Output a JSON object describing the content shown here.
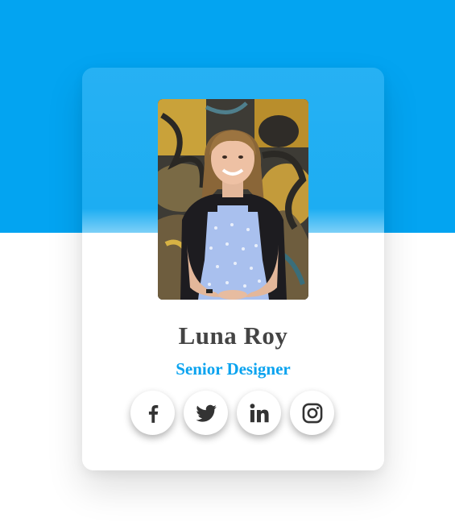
{
  "profile": {
    "name": "Luna Roy",
    "title": "Senior Designer"
  },
  "social_links": [
    {
      "icon": "facebook-icon"
    },
    {
      "icon": "twitter-icon"
    },
    {
      "icon": "linkedin-icon"
    },
    {
      "icon": "instagram-icon"
    }
  ],
  "colors": {
    "accent": "#03a4f1",
    "name_text": "#444444",
    "title_text": "#0aa3ef",
    "icon": "#333333"
  }
}
